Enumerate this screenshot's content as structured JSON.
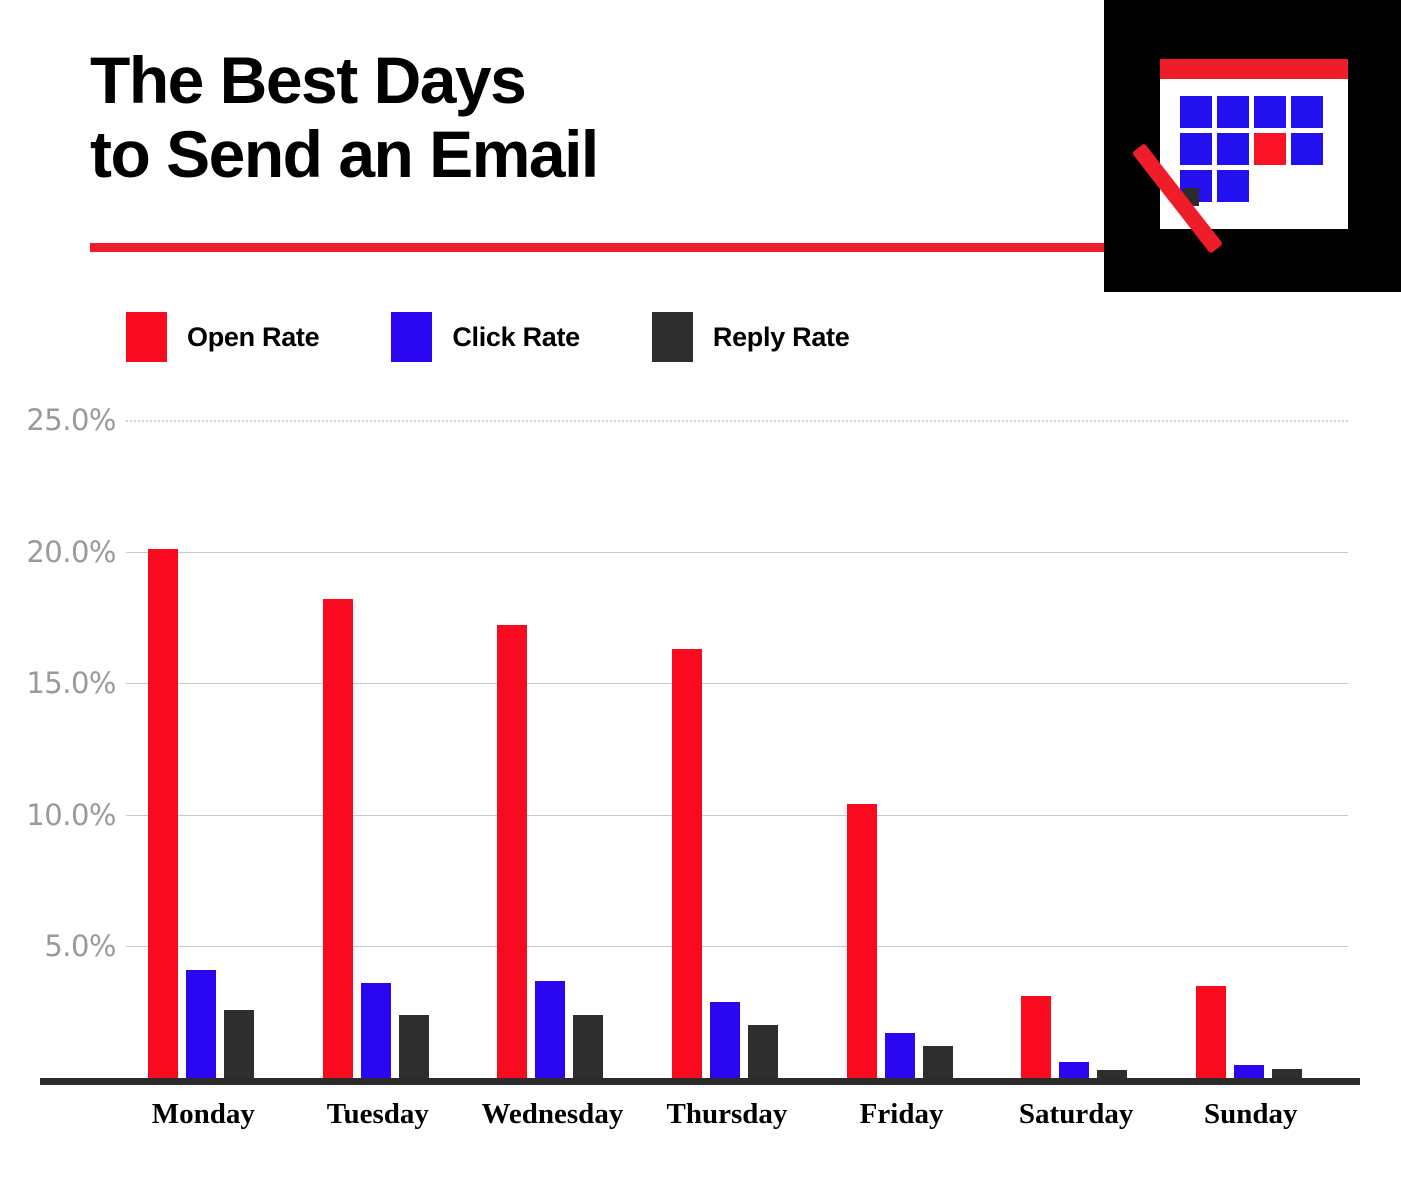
{
  "header": {
    "title": "The Best Days\nto Send an Email",
    "accent_color": "#ef1c2a"
  },
  "calendar_icon": {
    "name": "calendar-with-pen-icon",
    "header_bar_color": "#ef1c2a",
    "cell_color": "#2211ee",
    "highlight_cell_color": "#fa1324",
    "pen_color": "#ef1c2a",
    "background_color": "#000000"
  },
  "legend": {
    "items": [
      {
        "label": "Open Rate",
        "color": "#fa0a1e"
      },
      {
        "label": "Click Rate",
        "color": "#2a07f0"
      },
      {
        "label": "Reply Rate",
        "color": "#2e2e2e"
      }
    ]
  },
  "chart_data": {
    "type": "bar",
    "title": "The Best Days to Send an Email",
    "xlabel": "",
    "ylabel": "",
    "ylim": [
      0,
      25
    ],
    "yticks": [
      25.0,
      20.0,
      15.0,
      10.0,
      5.0
    ],
    "ytick_labels": [
      "25.0%",
      "20.0%",
      "15.0%",
      "10.0%",
      "5.0%"
    ],
    "grid": true,
    "legend_position": "top-left",
    "categories": [
      "Monday",
      "Tuesday",
      "Wednesday",
      "Thursday",
      "Friday",
      "Saturday",
      "Sunday"
    ],
    "series": [
      {
        "name": "Open Rate",
        "color": "#fa0a1e",
        "values": [
          20.1,
          18.2,
          17.2,
          16.3,
          10.4,
          3.1,
          3.5
        ]
      },
      {
        "name": "Click Rate",
        "color": "#2a07f0",
        "values": [
          4.1,
          3.6,
          3.7,
          2.9,
          1.7,
          0.6,
          0.5
        ]
      },
      {
        "name": "Reply Rate",
        "color": "#2e2e2e",
        "values": [
          2.6,
          2.4,
          2.4,
          2.0,
          1.2,
          0.3,
          0.35
        ]
      }
    ]
  }
}
